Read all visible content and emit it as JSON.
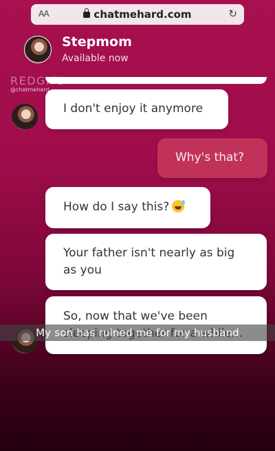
{
  "browser": {
    "text_size_label": "AA",
    "url": "chatmehard.com",
    "lock_icon": "lock-icon",
    "reload_icon": "reload-icon"
  },
  "header": {
    "contact_name": "Stepmom",
    "status": "Available now"
  },
  "watermark": {
    "logo": "REDGIFS",
    "handle": "@chatmehard"
  },
  "messages": [
    {
      "from": "contact",
      "text": "I don't enjoy it anymore"
    },
    {
      "from": "me",
      "text": "Why's that?"
    },
    {
      "from": "contact",
      "text": "How do I say this?",
      "emoji": "sweat-smile-emoji"
    },
    {
      "from": "contact",
      "text": "Your father isn't nearly as big as you"
    },
    {
      "from": "contact",
      "text": "So, now that we've been sleeping together for a while..."
    }
  ],
  "subtitle": "My son has ruined me for my husband",
  "colors": {
    "background_top": "#a8104f",
    "background_bottom": "#220010",
    "outgoing_bubble": "#c0325a",
    "incoming_bubble": "#ffffff"
  }
}
